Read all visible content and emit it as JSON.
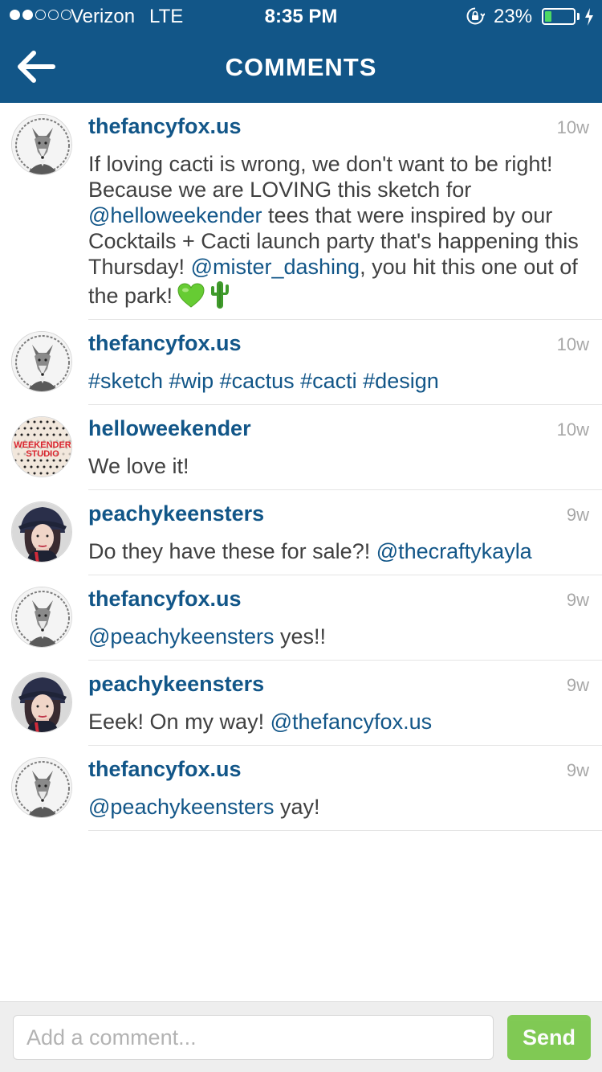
{
  "status_bar": {
    "carrier": "Verizon",
    "network": "LTE",
    "time": "8:35 PM",
    "battery_percent": "23%",
    "battery_level": 0.23,
    "signal_bars_filled": 2,
    "signal_bars_total": 5
  },
  "nav": {
    "back_icon": "arrow-left-icon",
    "title": "COMMENTS"
  },
  "comments": [
    {
      "user": "thefancyfox.us",
      "time": "10w",
      "avatar": "fox-avatar",
      "segments": [
        {
          "text": "If loving cacti is wrong, we don't want to be right! Because we are LOVING this sketch for ",
          "type": "text"
        },
        {
          "text": "@helloweekender",
          "type": "mention"
        },
        {
          "text": " tees that were inspired by our Cocktails + Cacti launch party that's happening this Thursday! ",
          "type": "text"
        },
        {
          "text": "@mister_dashing",
          "type": "mention"
        },
        {
          "text": ", you hit this one out of the park!",
          "type": "text"
        }
      ],
      "emojis": [
        "green-heart-icon",
        "cactus-icon"
      ]
    },
    {
      "user": "thefancyfox.us",
      "time": "10w",
      "avatar": "fox-avatar",
      "segments": [
        {
          "text": "#sketch #wip #cactus #cacti #design",
          "type": "mention"
        }
      ]
    },
    {
      "user": "helloweekender",
      "time": "10w",
      "avatar": "weekender-avatar",
      "avatar_text": [
        "WEEKENDER",
        "STUDIO"
      ],
      "segments": [
        {
          "text": "We love it!",
          "type": "text"
        }
      ]
    },
    {
      "user": "peachykeensters",
      "time": "9w",
      "avatar": "peachy-avatar",
      "segments": [
        {
          "text": "Do they have these for sale?! ",
          "type": "text"
        },
        {
          "text": "@thecraftykayla",
          "type": "mention"
        }
      ]
    },
    {
      "user": "thefancyfox.us",
      "time": "9w",
      "avatar": "fox-avatar",
      "segments": [
        {
          "text": "@peachykeensters",
          "type": "mention"
        },
        {
          "text": " yes!!",
          "type": "text"
        }
      ]
    },
    {
      "user": "peachykeensters",
      "time": "9w",
      "avatar": "peachy-avatar",
      "segments": [
        {
          "text": "Eeek! On my way! ",
          "type": "text"
        },
        {
          "text": "@thefancyfox.us",
          "type": "mention"
        }
      ]
    },
    {
      "user": "thefancyfox.us",
      "time": "9w",
      "avatar": "fox-avatar",
      "segments": [
        {
          "text": "@peachykeensters",
          "type": "mention"
        },
        {
          "text": " yay!",
          "type": "text"
        }
      ]
    }
  ],
  "composer": {
    "placeholder": "Add a comment...",
    "value": "",
    "send_label": "Send"
  },
  "colors": {
    "brand_blue": "#125688",
    "send_green": "#6dc33a",
    "timestamp_gray": "#a8a8a8",
    "text_gray": "#404040"
  }
}
